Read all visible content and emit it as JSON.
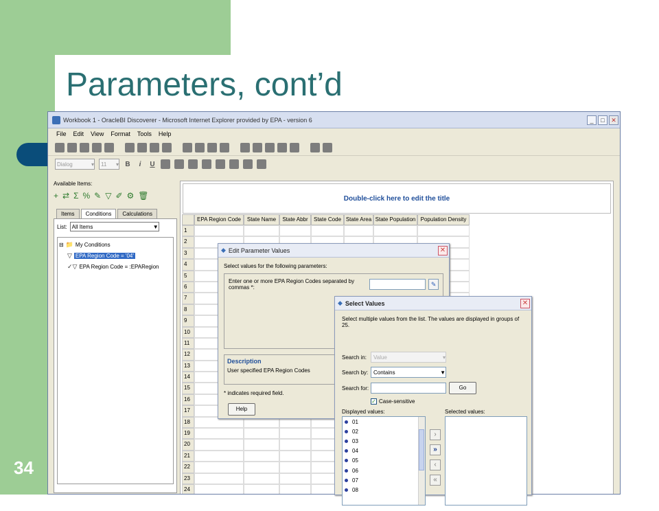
{
  "slide": {
    "title": "Parameters, cont’d",
    "number": "34"
  },
  "window": {
    "title": "Workbook 1 - OracleBI Discoverer - Microsoft Internet Explorer provided by EPA - version 6",
    "controls": {
      "minimize": "_",
      "maximize": "□",
      "close": "✕"
    }
  },
  "menu": [
    "File",
    "Edit",
    "View",
    "Format",
    "Tools",
    "Help"
  ],
  "format_bar": {
    "font": "Dialog",
    "size": "11",
    "bold": "B",
    "italic": "i",
    "underline": "U"
  },
  "left_panel": {
    "available_label": "Available Items:",
    "tabs": [
      "Items",
      "Conditions",
      "Calculations"
    ],
    "active_tab": "Conditions",
    "list_label": "List:",
    "list_value": "All Items",
    "tree": {
      "root": "My Conditions",
      "items": [
        {
          "label": "EPA Region Code = '04'",
          "selected": true
        },
        {
          "label": "EPA Region Code = :EPARegion",
          "selected": false
        }
      ]
    }
  },
  "sheet": {
    "title": "Double-click here to edit the title",
    "columns": [
      "EPA Region Code",
      "State Name",
      "State Abbr",
      "State Code",
      "State Area",
      "State Population",
      "Population Density"
    ],
    "rows": [
      "1",
      "2",
      "3",
      "4",
      "5",
      "6",
      "7",
      "8",
      "9",
      "10",
      "11",
      "12",
      "13",
      "14",
      "15",
      "16",
      "17",
      "18",
      "19",
      "20",
      "21",
      "22",
      "23",
      "24"
    ]
  },
  "edit_param_dialog": {
    "title": "Edit Parameter Values",
    "instruction": "Select values for the following parameters:",
    "prompt": "Enter one or more EPA Region Codes separated by commas *:",
    "description_heading": "Description",
    "description_text": "User specified EPA Region Codes",
    "required_note": "* indicates required field.",
    "help_button": "Help"
  },
  "select_values_dialog": {
    "title": "Select Values",
    "instruction": "Select multiple values from the list. The values are displayed in groups of 25.",
    "search_in_label": "Search in:",
    "search_in_value": "Value",
    "search_by_label": "Search by:",
    "search_by_value": "Contains",
    "search_for_label": "Search for:",
    "go_button": "Go",
    "case_sensitive_label": "Case-sensitive",
    "displayed_label": "Displayed values:",
    "selected_label": "Selected values:",
    "displayed_values": [
      "01",
      "02",
      "03",
      "04",
      "05",
      "06",
      "07",
      "08"
    ],
    "arrows": [
      "›",
      "»",
      "‹",
      "«"
    ]
  }
}
